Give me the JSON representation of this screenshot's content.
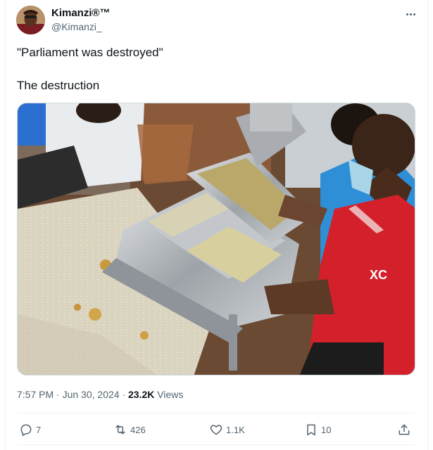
{
  "author": {
    "display_name": "Kimanzi®™",
    "handle": "@Kimanzi_"
  },
  "tweet": {
    "line1": "\"Parliament was destroyed\"",
    "line2": "The destruction"
  },
  "meta": {
    "time": "7:57 PM",
    "separator1": " · ",
    "date": "Jun 30, 2024",
    "separator2": " · ",
    "views_count": "23.2K",
    "views_label": " Views"
  },
  "actions": {
    "replies": "7",
    "reposts": "426",
    "likes": "1.1K",
    "bookmarks": "10"
  },
  "media": {
    "shirt_text": "XC"
  },
  "icons": {
    "more": "more-horizontal-icon",
    "reply": "reply-icon",
    "repost": "repost-icon",
    "like": "heart-icon",
    "bookmark": "bookmark-icon",
    "share": "share-icon"
  },
  "colors": {
    "text_primary": "#0f1419",
    "text_secondary": "#536471",
    "border": "#cfd9de",
    "shirt_red": "#d4202a",
    "shirt_blue": "#2f8fd6"
  }
}
